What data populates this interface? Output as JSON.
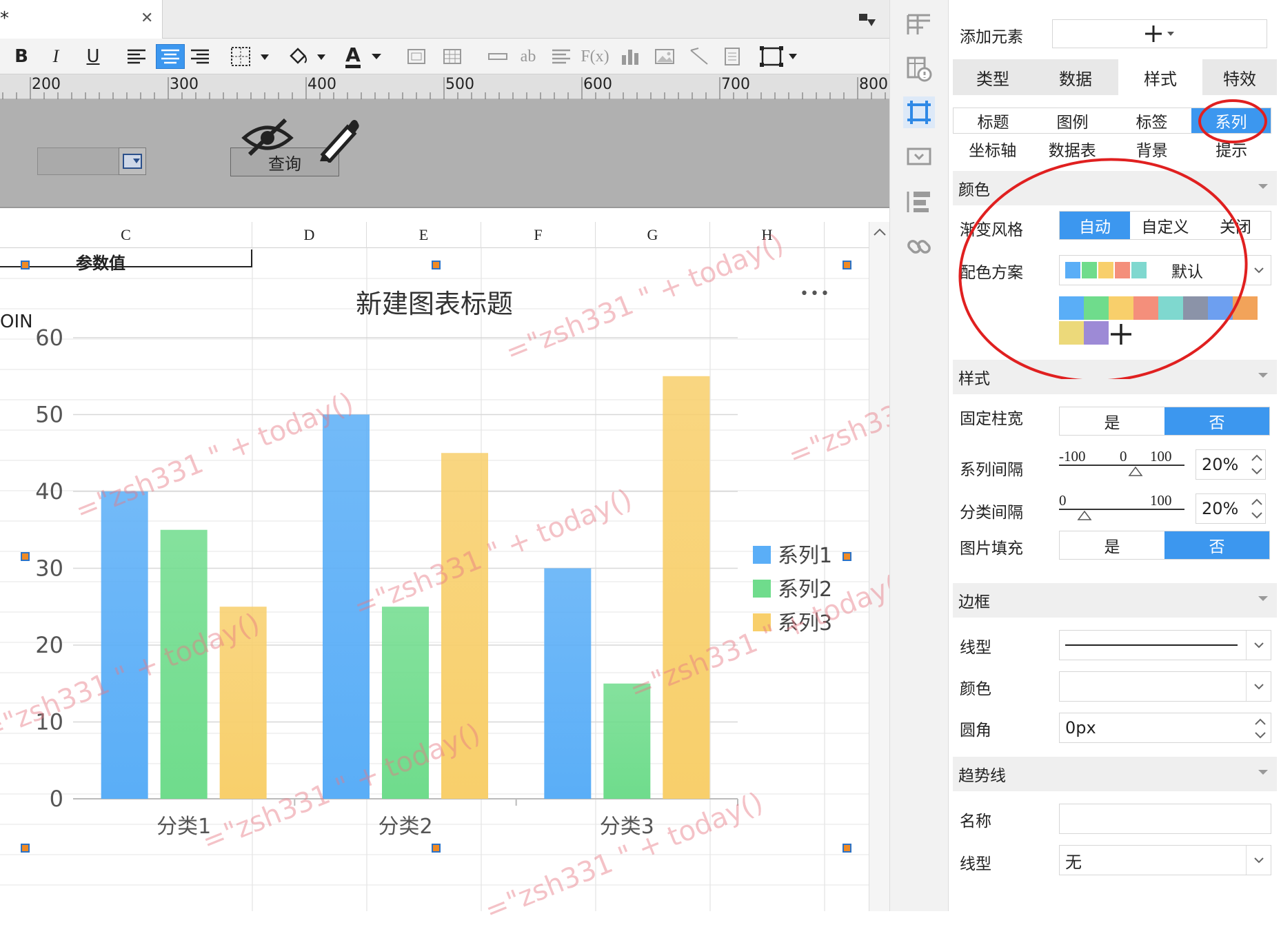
{
  "window": {
    "tab_label": "*",
    "close_glyph": "✕"
  },
  "toolbar": {
    "bold": "B",
    "italic": "I",
    "underline": "U",
    "font_color": "A",
    "text_box": "ab",
    "formula": "F(x)"
  },
  "ruler": {
    "labels": [
      "200",
      "300",
      "400",
      "500",
      "600",
      "700",
      "800"
    ]
  },
  "param_panel": {
    "query_label": "查询"
  },
  "grid": {
    "columns": [
      "C",
      "D",
      "E",
      "F",
      "G",
      "H"
    ],
    "cell_param_label": "参数值",
    "cell_partial": "OIN"
  },
  "chart_data": {
    "type": "bar",
    "title": "新建图表标题",
    "categories": [
      "分类1",
      "分类2",
      "分类3"
    ],
    "series": [
      {
        "name": "系列1",
        "values": [
          40,
          50,
          30
        ],
        "color": "#5aaef7"
      },
      {
        "name": "系列2",
        "values": [
          35,
          25,
          15
        ],
        "color": "#6fdc8c"
      },
      {
        "name": "系列3",
        "values": [
          25,
          45,
          55
        ],
        "color": "#f8cf6b"
      }
    ],
    "ylim": [
      0,
      60
    ],
    "yticks": [
      0,
      10,
      20,
      30,
      40,
      50,
      60
    ],
    "xlabel": "",
    "ylabel": "",
    "grid": true,
    "legend": "right",
    "more_glyph": "•••"
  },
  "watermark": {
    "text": "=\"zsh331 \" + today()"
  },
  "panel": {
    "add_element_label": "添加元素",
    "tabs": [
      "类型",
      "数据",
      "样式",
      "特效"
    ],
    "active_tab": "样式",
    "subtabs_row1": [
      "标题",
      "图例",
      "标签",
      "系列"
    ],
    "subtabs_row2": [
      "坐标轴",
      "数据表",
      "背景",
      "提示"
    ],
    "active_subtab": "系列",
    "color_section": "颜色",
    "gradient_label": "渐变风格",
    "gradient_options": [
      "自动",
      "自定义",
      "关闭"
    ],
    "gradient_selected": "自动",
    "scheme_label": "配色方案",
    "scheme_value": "默认",
    "scheme_colors": [
      "#5aaef7",
      "#6fdc8c",
      "#f8cf6b",
      "#f48f7b",
      "#7fd8cf"
    ],
    "palette": [
      "#5aaef7",
      "#6fdc8c",
      "#f8cf6b",
      "#f48f7b",
      "#7fd8cf",
      "#8b93a8",
      "#6d9ff0",
      "#f2a35a",
      "#ecd97a",
      "#9d8ad6"
    ],
    "style_section": "样式",
    "fixed_width_label": "固定柱宽",
    "yes": "是",
    "no": "否",
    "series_gap_label": "系列间隔",
    "series_gap_min": "-100",
    "series_gap_mid": "0",
    "series_gap_max": "100",
    "series_gap_value": "20%",
    "category_gap_label": "分类间隔",
    "category_gap_min": "0",
    "category_gap_max": "100",
    "category_gap_value": "20%",
    "image_fill_label": "图片填充",
    "border_section": "边框",
    "line_type_label": "线型",
    "color_label": "颜色",
    "radius_label": "圆角",
    "radius_value": "0px",
    "trend_section": "趋势线",
    "name_label": "名称",
    "trend_line_type_label": "线型",
    "trend_line_type_value": "无"
  },
  "colors": {
    "accent": "#3c97ef",
    "annotation": "#e02020"
  }
}
